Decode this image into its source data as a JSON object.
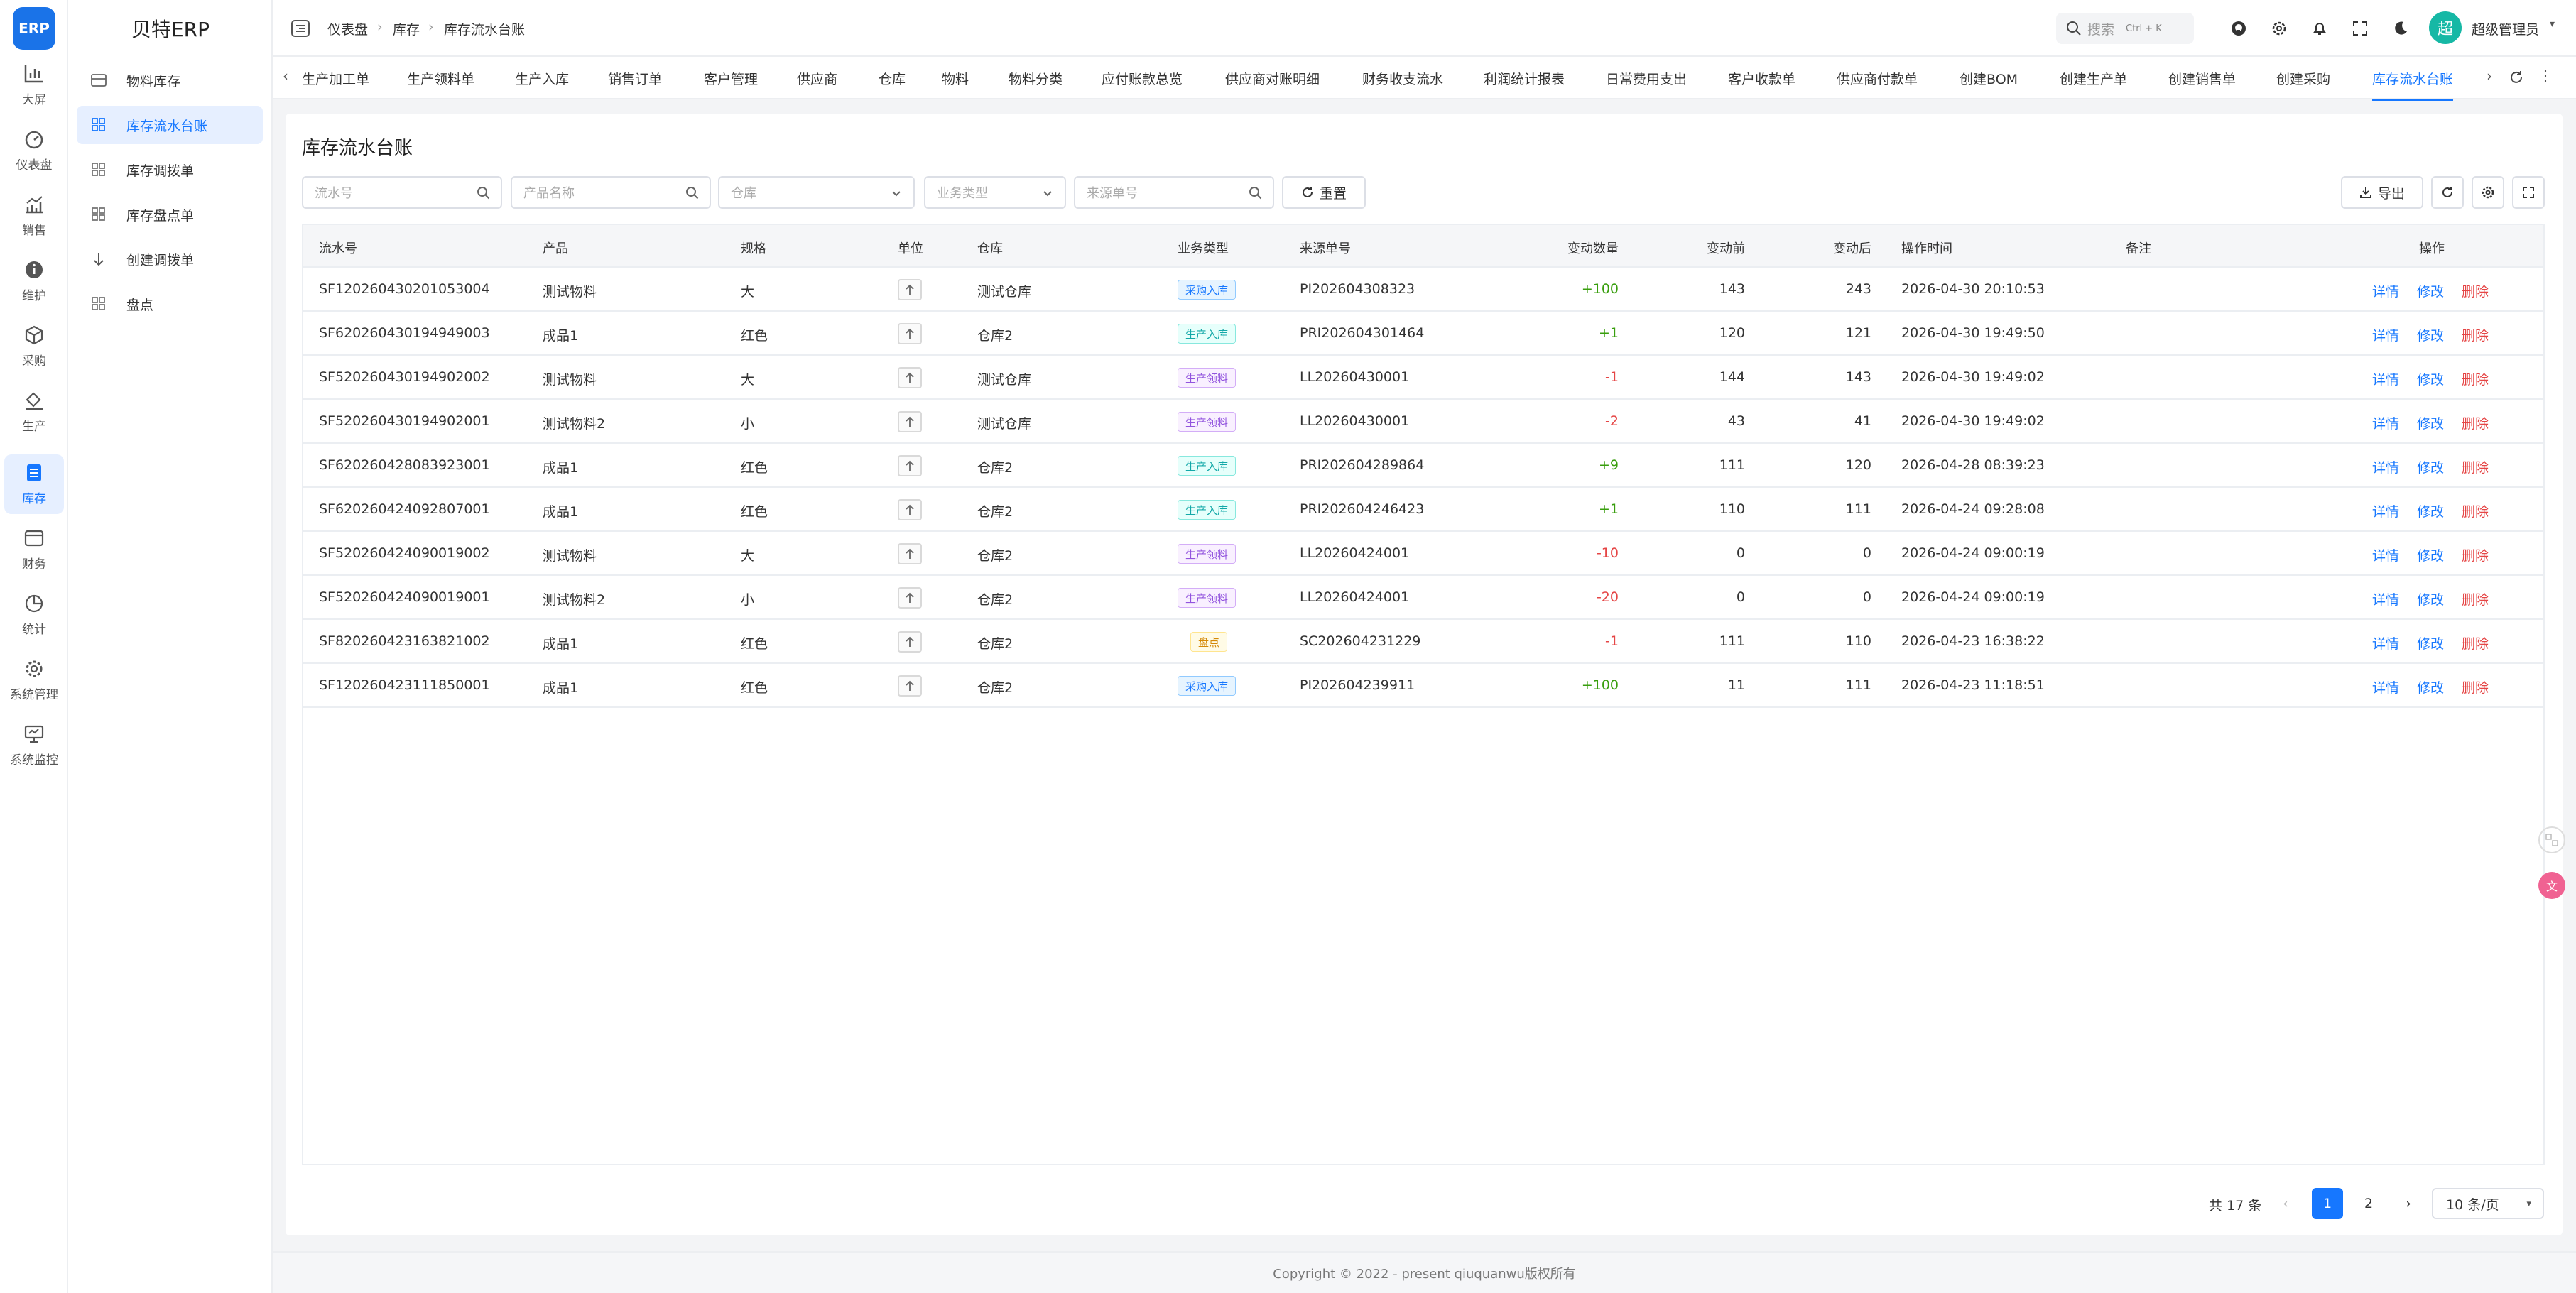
{
  "app": {
    "logo_text": "ERP",
    "brand": "贝特ERP"
  },
  "rail": [
    {
      "label": "大屏",
      "icon": "bar-chart-icon"
    },
    {
      "label": "仪表盘",
      "icon": "dashboard-icon"
    },
    {
      "label": "销售",
      "icon": "sales-chart-icon"
    },
    {
      "label": "维护",
      "icon": "info-icon"
    },
    {
      "label": "采购",
      "icon": "cube-icon"
    },
    {
      "label": "生产",
      "icon": "paint-bucket-icon"
    },
    {
      "label": "库存",
      "icon": "inventory-icon",
      "active": true
    },
    {
      "label": "财务",
      "icon": "wallet-icon"
    },
    {
      "label": "统计",
      "icon": "pie-icon"
    },
    {
      "label": "系统管理",
      "icon": "gear-icon"
    },
    {
      "label": "系统监控",
      "icon": "monitor-icon"
    }
  ],
  "submenu": [
    {
      "label": "物料库存",
      "icon": "table-icon"
    },
    {
      "label": "库存流水台账",
      "icon": "grid-icon",
      "active": true
    },
    {
      "label": "库存调拨单",
      "icon": "grid-icon"
    },
    {
      "label": "库存盘点单",
      "icon": "grid-icon"
    },
    {
      "label": "创建调拨单",
      "icon": "arrow-down-icon"
    },
    {
      "label": "盘点",
      "icon": "grid-icon"
    }
  ],
  "breadcrumb": [
    "仪表盘",
    "库存",
    "库存流水台账"
  ],
  "header": {
    "search_placeholder": "搜索",
    "search_shortcut": "Ctrl + K",
    "avatar_text": "超",
    "user_name": "超级管理员"
  },
  "tabs": [
    "生产加工单",
    "生产领料单",
    "生产入库",
    "销售订单",
    "客户管理",
    "供应商",
    "仓库",
    "物料",
    "物料分类",
    "应付账款总览",
    "供应商对账明细",
    "财务收支流水",
    "利润统计报表",
    "日常费用支出",
    "客户收款单",
    "供应商付款单",
    "创建BOM",
    "创建生产单",
    "创建销售单",
    "创建采购",
    "库存流水台账"
  ],
  "active_tab": "库存流水台账",
  "page": {
    "title": "库存流水台账",
    "filters": {
      "serial": "流水号",
      "product": "产品名称",
      "warehouse": "仓库",
      "biz_type": "业务类型",
      "source": "来源单号"
    },
    "reset_label": "重置",
    "export_label": "导出"
  },
  "table": {
    "columns": [
      "流水号",
      "产品",
      "规格",
      "单位",
      "仓库",
      "业务类型",
      "来源单号",
      "变动数量",
      "变动前",
      "变动后",
      "操作时间",
      "备注",
      "操作"
    ],
    "actions": {
      "detail": "详情",
      "edit": "修改",
      "delete": "删除"
    },
    "unit_symbol": "个",
    "rows": [
      {
        "serial": "SF120260430201053004",
        "product": "测试物料",
        "spec": "大",
        "warehouse": "测试仓库",
        "type": "采购入库",
        "type_color": "blue",
        "source": "PI202604308323",
        "change": "+100",
        "dir": "pos",
        "before": "143",
        "after": "243",
        "time": "2026-04-30 20:10:53"
      },
      {
        "serial": "SF620260430194949003",
        "product": "成品1",
        "spec": "红色",
        "warehouse": "仓库2",
        "type": "生产入库",
        "type_color": "cyan",
        "source": "PRI202604301464",
        "change": "+1",
        "dir": "pos",
        "before": "120",
        "after": "121",
        "time": "2026-04-30 19:49:50"
      },
      {
        "serial": "SF520260430194902002",
        "product": "测试物料",
        "spec": "大",
        "warehouse": "测试仓库",
        "type": "生产领料",
        "type_color": "purple",
        "source": "LL20260430001",
        "change": "-1",
        "dir": "neg",
        "before": "144",
        "after": "143",
        "time": "2026-04-30 19:49:02"
      },
      {
        "serial": "SF520260430194902001",
        "product": "测试物料2",
        "spec": "小",
        "warehouse": "测试仓库",
        "type": "生产领料",
        "type_color": "purple",
        "source": "LL20260430001",
        "change": "-2",
        "dir": "neg",
        "before": "43",
        "after": "41",
        "time": "2026-04-30 19:49:02"
      },
      {
        "serial": "SF620260428083923001",
        "product": "成品1",
        "spec": "红色",
        "warehouse": "仓库2",
        "type": "生产入库",
        "type_color": "cyan",
        "source": "PRI202604289864",
        "change": "+9",
        "dir": "pos",
        "before": "111",
        "after": "120",
        "time": "2026-04-28 08:39:23"
      },
      {
        "serial": "SF620260424092807001",
        "product": "成品1",
        "spec": "红色",
        "warehouse": "仓库2",
        "type": "生产入库",
        "type_color": "cyan",
        "source": "PRI202604246423",
        "change": "+1",
        "dir": "pos",
        "before": "110",
        "after": "111",
        "time": "2026-04-24 09:28:08"
      },
      {
        "serial": "SF520260424090019002",
        "product": "测试物料",
        "spec": "大",
        "warehouse": "仓库2",
        "type": "生产领料",
        "type_color": "purple",
        "source": "LL20260424001",
        "change": "-10",
        "dir": "neg",
        "before": "0",
        "after": "0",
        "time": "2026-04-24 09:00:19"
      },
      {
        "serial": "SF520260424090019001",
        "product": "测试物料2",
        "spec": "小",
        "warehouse": "仓库2",
        "type": "生产领料",
        "type_color": "purple",
        "source": "LL20260424001",
        "change": "-20",
        "dir": "neg",
        "before": "0",
        "after": "0",
        "time": "2026-04-24 09:00:19"
      },
      {
        "serial": "SF820260423163821002",
        "product": "成品1",
        "spec": "红色",
        "warehouse": "仓库2",
        "type": "盘点",
        "type_color": "gold",
        "source": "SC202604231229",
        "change": "-1",
        "dir": "neg",
        "before": "111",
        "after": "110",
        "time": "2026-04-23 16:38:22"
      },
      {
        "serial": "SF120260423111850001",
        "product": "成品1",
        "spec": "红色",
        "warehouse": "仓库2",
        "type": "采购入库",
        "type_color": "blue",
        "source": "PI202604239911",
        "change": "+100",
        "dir": "pos",
        "before": "11",
        "after": "111",
        "time": "2026-04-23 11:18:51"
      }
    ]
  },
  "pagination": {
    "total": "共 17 条",
    "pages": [
      "1",
      "2"
    ],
    "current": "1",
    "page_size": "10 条/页"
  },
  "footer": "Copyright © 2022 - present qiuquanwu版权所有",
  "colors": {
    "accent": "#1677ff",
    "positive": "#389e0d",
    "negative": "#e54545"
  }
}
